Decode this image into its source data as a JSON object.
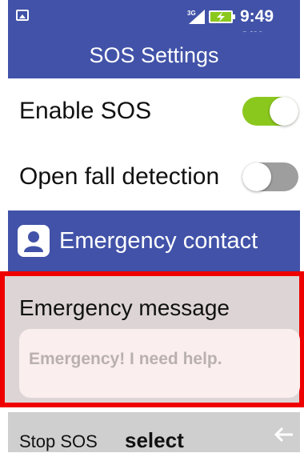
{
  "status_bar": {
    "network_type": "3G",
    "time": "9:49 am",
    "icons": [
      "image-icon",
      "signal-icon",
      "battery-charging-icon"
    ]
  },
  "header": {
    "title": "SOS Settings"
  },
  "settings": {
    "enable_sos": {
      "label": "Enable SOS",
      "enabled": true
    },
    "fall_detection": {
      "label": "Open fall detection",
      "enabled": false
    }
  },
  "emergency_contact": {
    "label": "Emergency contact",
    "icon": "person-icon"
  },
  "emergency_message": {
    "label": "Emergency message",
    "value": "Emergency! I need help.",
    "selected": true
  },
  "softkeys": {
    "left": "Stop SOS",
    "center": "select",
    "right_icon": "back-arrow-icon"
  },
  "colors": {
    "header_bg": "#4152a8",
    "toggle_on": "#8bc81e",
    "toggle_off": "#9e9e9e",
    "selection_border": "#ef0000"
  }
}
